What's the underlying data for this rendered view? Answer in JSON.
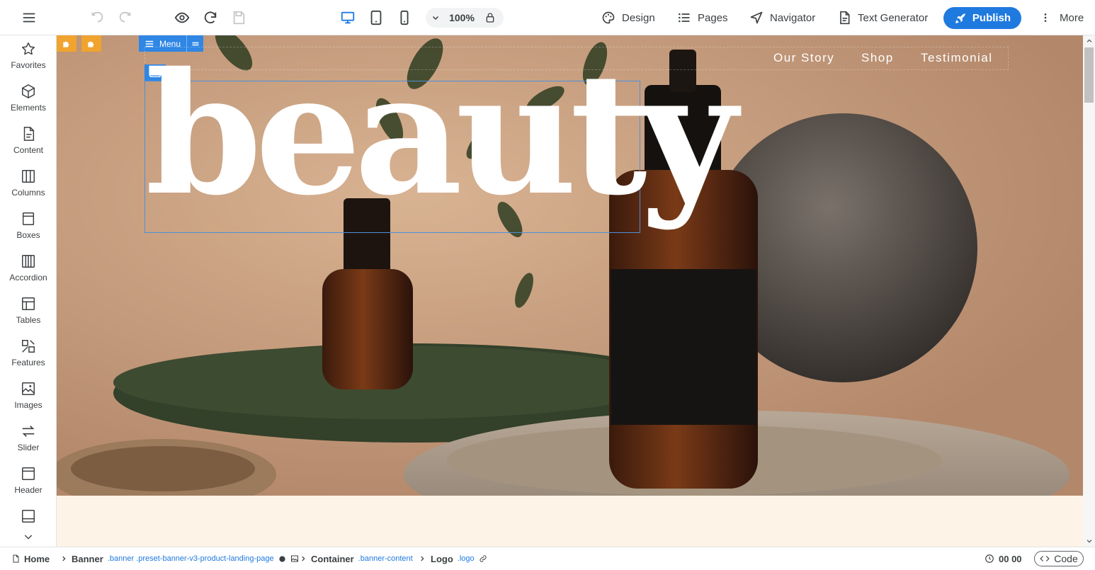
{
  "toolbar": {
    "zoom": "100%",
    "design_label": "Design",
    "pages_label": "Pages",
    "navigator_label": "Navigator",
    "text_generator_label": "Text Generator",
    "publish_label": "Publish",
    "more_label": "More"
  },
  "sidebar": {
    "items": [
      {
        "label": "Favorites",
        "icon": "star-icon"
      },
      {
        "label": "Elements",
        "icon": "cube-icon"
      },
      {
        "label": "Content",
        "icon": "document-icon"
      },
      {
        "label": "Columns",
        "icon": "columns-icon"
      },
      {
        "label": "Boxes",
        "icon": "box-icon"
      },
      {
        "label": "Accordion",
        "icon": "accordion-icon"
      },
      {
        "label": "Tables",
        "icon": "table-icon"
      },
      {
        "label": "Features",
        "icon": "features-icon"
      },
      {
        "label": "Images",
        "icon": "image-icon"
      },
      {
        "label": "Slider",
        "icon": "slider-icon"
      },
      {
        "label": "Header",
        "icon": "header-icon"
      },
      {
        "label": "",
        "icon": "footer-icon"
      }
    ]
  },
  "canvas": {
    "menu_tag": "Menu",
    "nav": [
      "Our Story",
      "Shop",
      "Testimonial"
    ],
    "logo_text": "beauty"
  },
  "breadcrumb": {
    "home": "Home",
    "banner": "Banner",
    "banner_classes": ".banner .preset-banner-v3-product-landing-page",
    "container": "Container",
    "container_classes": ".banner-content",
    "logo": "Logo",
    "logo_classes": ".logo"
  },
  "status": {
    "timer": "00 00",
    "code_label": "Code"
  },
  "colors": {
    "accent": "#1f7ae0",
    "tag_blue": "#2f86e4",
    "tag_orange": "#f0a32e",
    "section_bg": "#fdf3e6"
  }
}
